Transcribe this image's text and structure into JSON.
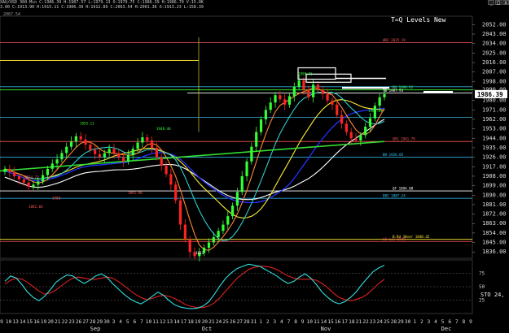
{
  "window": {
    "header_line1": "XAU/USD 360-Min  C:1986.39  H:1987.57  L:1979.13  O:1979.75  C:1986.39  H:1986.70  V:15.0K",
    "header_line2": "3.00  C:1913.90 H:1915.11  C:1906.39  H:1912.86  C:2063.54  H:2001.36  O:1913.23  L:158.39",
    "header_sub": "2067.54",
    "minimize": "_",
    "maximize": "□",
    "close": "x"
  },
  "chart_title": "T=Q Levels New",
  "colors": {
    "background": "#000000",
    "up_candle": "#33ff33",
    "down_candle": "#ff2222",
    "blue_ma": "#2233ff",
    "yellow_ma": "#ffee33",
    "green_ma": "#33dd33",
    "white_ma": "#ffffff",
    "orange_ma": "#ff8833",
    "cyan_ma": "#33cccc",
    "stoch_k": "#33dddd",
    "stoch_d": "#dd2222"
  },
  "chart_data": [
    {
      "type": "candlestick",
      "ylim": [
        1830,
        2060
      ],
      "y_ticks": [
        2052,
        2043,
        2034,
        2025,
        2016,
        2007,
        1998,
        1990,
        1980,
        1971,
        1962,
        1953,
        1944,
        1935,
        1926,
        1917,
        1908,
        1899,
        1890,
        1881,
        1872,
        1863,
        1854,
        1845,
        1836
      ],
      "y_tick_labels": [
        "2052.00",
        "2043.00",
        "2034.00",
        "2025.00",
        "2016.00",
        "2007.00",
        "1998.00",
        "1990.00",
        "1980.00",
        "1971.00",
        "1962.00",
        "1953.00",
        "1944.00",
        "1935.00",
        "1926.00",
        "1917.00",
        "1908.00",
        "1899.00",
        "1890.00",
        "1881.00",
        "1872.00",
        "1863.00",
        "1854.00",
        "1845.00",
        "1836.00"
      ],
      "last_price_label": "1986.39",
      "x_labels": [
        "9",
        "10",
        "13",
        "14",
        "15",
        "16",
        "19",
        "20",
        "21",
        "22",
        "23",
        "26",
        "27",
        "28",
        "29",
        "30",
        "3",
        "4",
        "5",
        "6",
        "7",
        "10",
        "11",
        "12",
        "13",
        "14",
        "17",
        "18",
        "19",
        "20",
        "21",
        "24",
        "25",
        "26",
        "27",
        "28",
        "31",
        "1",
        "2",
        "3",
        "4",
        "7",
        "8",
        "9",
        "10",
        "11",
        "14",
        "15",
        "16",
        "17",
        "18",
        "21",
        "22",
        "23",
        "24",
        "25",
        "28",
        "29",
        "30",
        "1",
        "2",
        "3",
        "4",
        "5",
        "6",
        "7",
        "8",
        "9"
      ],
      "month_labels": [
        "Sep",
        "Oct",
        "Nov",
        "Dec"
      ],
      "closes": [
        1915,
        1912,
        1908,
        1905,
        1902,
        1898,
        1900,
        1903,
        1909,
        1915,
        1920,
        1924,
        1930,
        1936,
        1941,
        1946,
        1943,
        1938,
        1933,
        1929,
        1926,
        1930,
        1934,
        1930,
        1926,
        1922,
        1928,
        1934,
        1940,
        1945,
        1942,
        1935,
        1926,
        1918,
        1910,
        1900,
        1885,
        1862,
        1848,
        1836,
        1832,
        1835,
        1840,
        1845,
        1850,
        1856,
        1862,
        1870,
        1880,
        1893,
        1908,
        1922,
        1936,
        1950,
        1962,
        1971,
        1978,
        1985,
        1981,
        1976,
        1984,
        1993,
        1999,
        1990,
        1983,
        1995,
        1990,
        1986,
        1980,
        1976,
        1966,
        1958,
        1950,
        1944,
        1942,
        1947,
        1955,
        1963,
        1975,
        1983,
        1986
      ],
      "horizontal_levels": [
        {
          "label": "WR2 2035.19",
          "value": 2035,
          "color": "#ff5555"
        },
        {
          "label": "RR 1990.92",
          "value": 1990,
          "color": "#33ff33"
        },
        {
          "label": "TB 1987.93",
          "value": 1987,
          "color": "#ffffff"
        },
        {
          "label": "QR1 1941.79",
          "value": 1941,
          "color": "#ff5555"
        },
        {
          "label": "BH 1926.05",
          "value": 1926,
          "color": "#33ccff"
        },
        {
          "label": "QF 1894.00",
          "value": 1894,
          "color": "#ffffff"
        },
        {
          "label": "DB2 1887.24",
          "value": 1887,
          "color": "#33ccff"
        },
        {
          "label": "B.Rd 30ver 1848.42",
          "value": 1848,
          "color": "#ffee33"
        },
        {
          "label": "LD Low 1848",
          "value": 1846,
          "color": "#ff5555"
        }
      ],
      "annotations": [
        "1998.86",
        "1955.11",
        "1948.46",
        "1914.72",
        "1900",
        "1882.84",
        "1891.90",
        "1831",
        "1967.21"
      ]
    },
    {
      "type": "line",
      "name": "STO",
      "label": "STO 24,",
      "ylim": [
        0,
        100
      ],
      "y_ticks": [
        75,
        50,
        25
      ],
      "k": [
        60,
        70,
        66,
        54,
        40,
        30,
        24,
        32,
        44,
        58,
        66,
        72,
        70,
        62,
        56,
        62,
        70,
        74,
        68,
        56,
        46,
        36,
        28,
        22,
        18,
        24,
        32,
        40,
        34,
        24,
        16,
        12,
        10,
        9,
        10,
        14,
        22,
        36,
        52,
        66,
        76,
        84,
        88,
        92,
        90,
        88,
        82,
        76,
        70,
        62,
        56,
        60,
        68,
        74,
        66,
        54,
        40,
        30,
        22,
        18,
        22,
        30,
        40,
        54,
        66,
        78,
        85,
        90
      ],
      "d": [
        55,
        62,
        66,
        64,
        58,
        50,
        42,
        36,
        38,
        44,
        52,
        60,
        66,
        68,
        66,
        64,
        64,
        66,
        68,
        66,
        60,
        52,
        44,
        36,
        30,
        26,
        28,
        32,
        34,
        32,
        28,
        22,
        16,
        13,
        11,
        11,
        14,
        20,
        30,
        42,
        54,
        66,
        74,
        82,
        86,
        88,
        88,
        86,
        82,
        76,
        70,
        66,
        64,
        64,
        64,
        62,
        56,
        48,
        38,
        30,
        26,
        24,
        26,
        30,
        36,
        46,
        56,
        64
      ]
    }
  ]
}
